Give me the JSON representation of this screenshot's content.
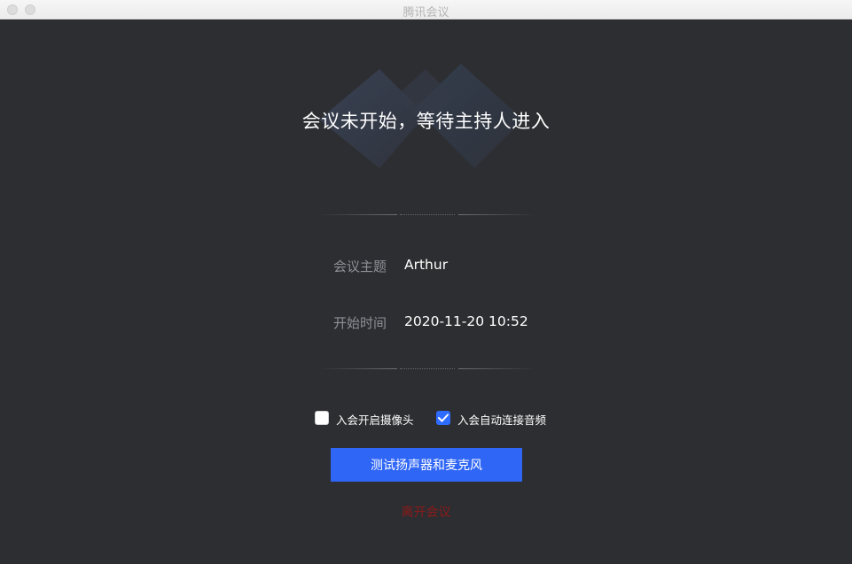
{
  "window": {
    "title": "腾讯会议"
  },
  "main": {
    "headline": "会议未开始，等待主持人进入",
    "info": [
      {
        "label": "会议主题",
        "value": "Arthur"
      },
      {
        "label": "开始时间",
        "value": "2020-11-20 10:52"
      }
    ],
    "options": [
      {
        "label": "入会开启摄像头",
        "checked": false
      },
      {
        "label": "入会自动连接音频",
        "checked": true
      }
    ],
    "test_button_label": "测试扬声器和麦克风",
    "leave_label": "离开会议"
  },
  "colors": {
    "background": "#2d2e31",
    "accent": "#2f66f6",
    "leave": "#8b1a1a",
    "muted_label": "#8e9096"
  },
  "icons": {
    "logo": "tencent-meeting-logo",
    "check": "check-icon"
  }
}
